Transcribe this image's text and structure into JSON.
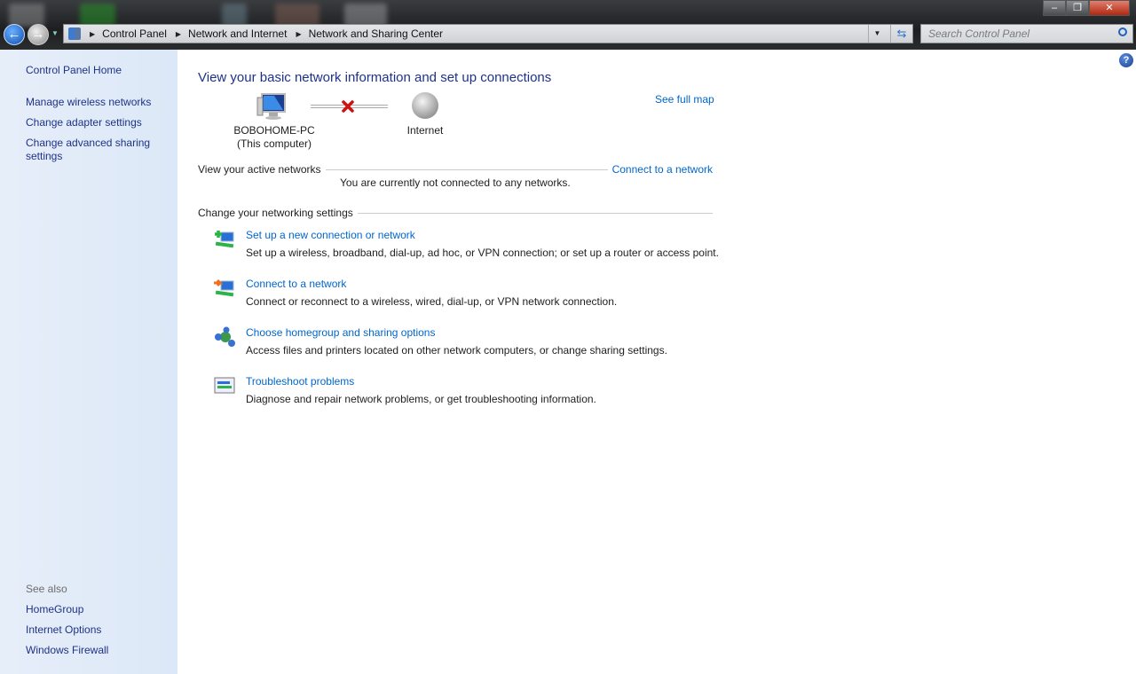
{
  "window": {
    "minimize_icon": "minimize-icon",
    "maximize_icon": "restore-icon",
    "close_icon": "close-icon"
  },
  "nav": {
    "back_icon": "back-arrow-icon",
    "forward_icon": "forward-arrow-icon"
  },
  "address": {
    "breadcrumbs": [
      "Control Panel",
      "Network and Internet",
      "Network and Sharing Center"
    ]
  },
  "search": {
    "placeholder": "Search Control Panel"
  },
  "sidebar": {
    "items": [
      {
        "label": "Control Panel Home"
      },
      {
        "label": "Manage wireless networks"
      },
      {
        "label": "Change adapter settings"
      },
      {
        "label": "Change advanced sharing settings"
      }
    ],
    "see_also_label": "See also",
    "see_also": [
      {
        "label": "HomeGroup"
      },
      {
        "label": "Internet Options"
      },
      {
        "label": "Windows Firewall"
      }
    ]
  },
  "main": {
    "title": "View your basic network information and set up connections",
    "see_full_map": "See full map",
    "map": {
      "computer_name": "BOBOHOME-PC",
      "computer_sub": "(This computer)",
      "internet": "Internet",
      "status": "disconnected"
    },
    "active_networks": {
      "heading": "View your active networks",
      "link": "Connect to a network",
      "message": "You are currently not connected to any networks."
    },
    "settings": {
      "heading": "Change your networking settings",
      "tasks": [
        {
          "label": "Set up a new connection or network",
          "desc": "Set up a wireless, broadband, dial-up, ad hoc, or VPN connection; or set up a router or access point.",
          "icon": "new-connection-icon"
        },
        {
          "label": "Connect to a network",
          "desc": "Connect or reconnect to a wireless, wired, dial-up, or VPN network connection.",
          "icon": "connect-network-icon"
        },
        {
          "label": "Choose homegroup and sharing options",
          "desc": "Access files and printers located on other network computers, or change sharing settings.",
          "icon": "homegroup-icon"
        },
        {
          "label": "Troubleshoot problems",
          "desc": "Diagnose and repair network problems, or get troubleshooting information.",
          "icon": "troubleshoot-icon"
        }
      ]
    }
  }
}
